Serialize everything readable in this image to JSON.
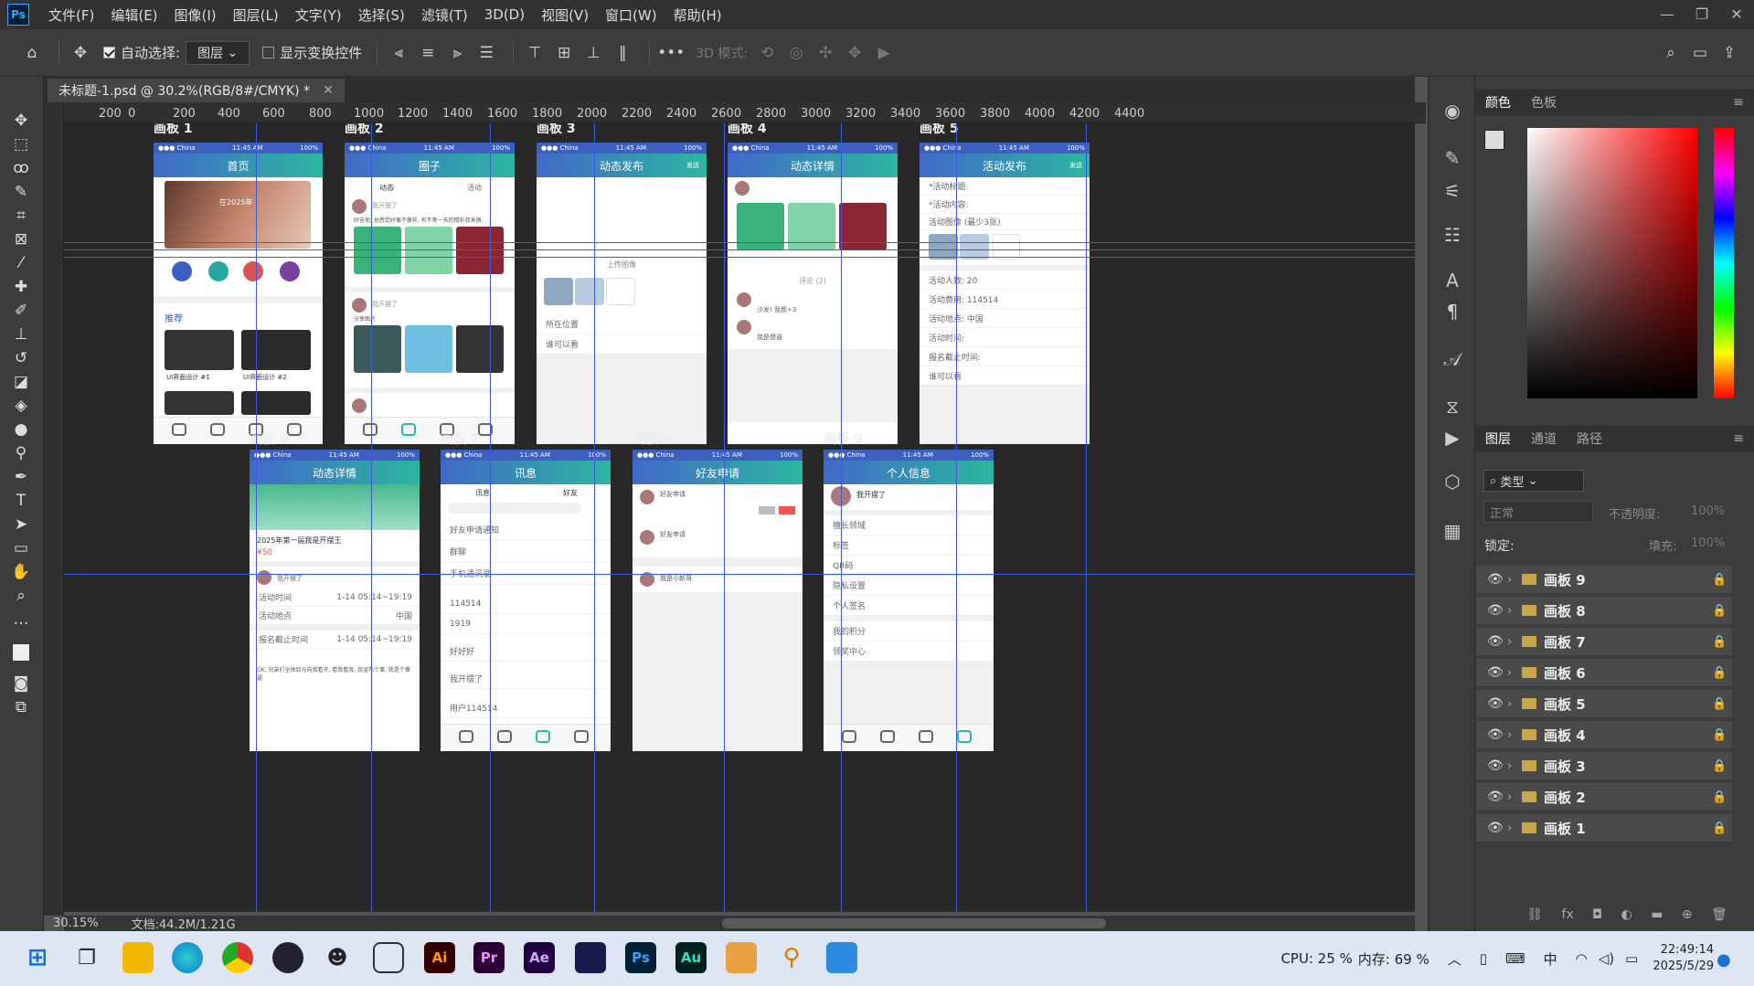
{
  "menu": {
    "logo": "Ps",
    "items": [
      "文件(F)",
      "编辑(E)",
      "图像(I)",
      "图层(L)",
      "文字(Y)",
      "选择(S)",
      "滤镜(T)",
      "3D(D)",
      "视图(V)",
      "窗口(W)",
      "帮助(H)"
    ]
  },
  "options": {
    "auto_select_label": "自动选择:",
    "auto_select_value": "图层",
    "show_transform_label": "显示变换控件",
    "mode_3d_label": "3D 模式:"
  },
  "document": {
    "tab_title": "未标题-1.psd @ 30.2%(RGB/8#/CMYK) *",
    "zoom": "30.15%",
    "doc_size": "文档:44.2M/1.21G"
  },
  "ruler_top": [
    "200",
    "0",
    "200",
    "400",
    "600",
    "800",
    "1000",
    "1200",
    "1400",
    "1600",
    "1800",
    "2000",
    "2200",
    "2400",
    "2600",
    "2800",
    "3000",
    "3200",
    "3400",
    "3600",
    "3800",
    "4000",
    "4200",
    "4400"
  ],
  "artboards": {
    "a1": {
      "label": "画板 1",
      "title": "首页",
      "section": "推荐",
      "card1": "UI界面设计 #1",
      "card2": "UI界面设计 #2",
      "banner": "在2025年"
    },
    "a2": {
      "label": "画板 2",
      "title": "圈子",
      "tab1": "动态",
      "tab2": "活动",
      "user": "我开摆了",
      "post1": "好吉他, 总感觉好像不像样, 有不等一天的精彩我来换.",
      "post2": "分享图片"
    },
    "a3": {
      "label": "画板 3",
      "title": "动态发布",
      "send": "发送",
      "upload": "上传图像",
      "loc": "所在位置",
      "who": "谁可以看"
    },
    "a4": {
      "label": "画板 4",
      "title": "动态详情",
      "comments": "评论 (2)",
      "c1": "沙发! 我都+3",
      "c2": "我是傻逼"
    },
    "a5": {
      "label": "画板 5",
      "title": "活动发布",
      "send": "发送",
      "f1": "*活动标题:",
      "f2": "*活动内容:",
      "f3": "活动图像 (最少3张)",
      "f4": "活动人数: 20",
      "f5": "活动费用: 114514",
      "f6": "活动地点: 中国",
      "f7": "活动时间:",
      "f8": "报名截止时间:",
      "f9": "谁可以看"
    },
    "a6": {
      "label": "画板 6",
      "title": "动态详情",
      "event": "2025年第一届我是开摆王",
      "price": "¥50",
      "user": "我开摆了",
      "r1": "活动时间",
      "r1v": "1-14 05:14~19:19",
      "r2": "活动地点",
      "r2v": "中国",
      "r3": "报名截止时间",
      "r3v": "1-14 05:14~19:19",
      "desc": "OK, 兄弟们全体目光向我看齐, 看我看我, 我宣布个事, 我是个傻逼"
    },
    "a7": {
      "label": "画板 7",
      "title": "讯息",
      "tab1": "讯息",
      "tab2": "好友",
      "i1": "好友申请通知",
      "i2": "群聊",
      "i3": "手机通讯录",
      "u1": "114514",
      "u2": "1919",
      "u3": "好好好",
      "u4": "我开摆了",
      "u5": "用户114514"
    },
    "a8": {
      "label": "画板 8",
      "title": "好友申请",
      "r1": "好友申请",
      "r2": "好友申请",
      "r3": "我是小新哥"
    },
    "a9": {
      "label": "画板 9",
      "title": "个人信息",
      "name": "我开摆了",
      "f1": "擅长领域",
      "f2": "标签",
      "f3": "QR码",
      "f4": "隐私设置",
      "f5": "个人签名",
      "f6": "我的积分",
      "f7": "领奖中心"
    }
  },
  "color_panel": {
    "tab1": "颜色",
    "tab2": "色板"
  },
  "layers_panel": {
    "tab1": "图层",
    "tab2": "通道",
    "tab3": "路径",
    "filter": "类型",
    "blend": "正常",
    "opacity_label": "不透明度:",
    "opacity": "100%",
    "lock_label": "锁定:",
    "fill_label": "填充:",
    "fill": "100%",
    "layers": [
      "画板 9",
      "画板 8",
      "画板 7",
      "画板 6",
      "画板 5",
      "画板 4",
      "画板 3",
      "画板 2",
      "画板 1"
    ]
  },
  "taskbar": {
    "cpu": "CPU: 25 %",
    "mem": "内存: 69 %",
    "ime": "中",
    "time": "22:49:14",
    "date": "2025/5/29",
    "apps": [
      "Ai",
      "Pr",
      "Ae",
      "Ps",
      "Au"
    ]
  }
}
